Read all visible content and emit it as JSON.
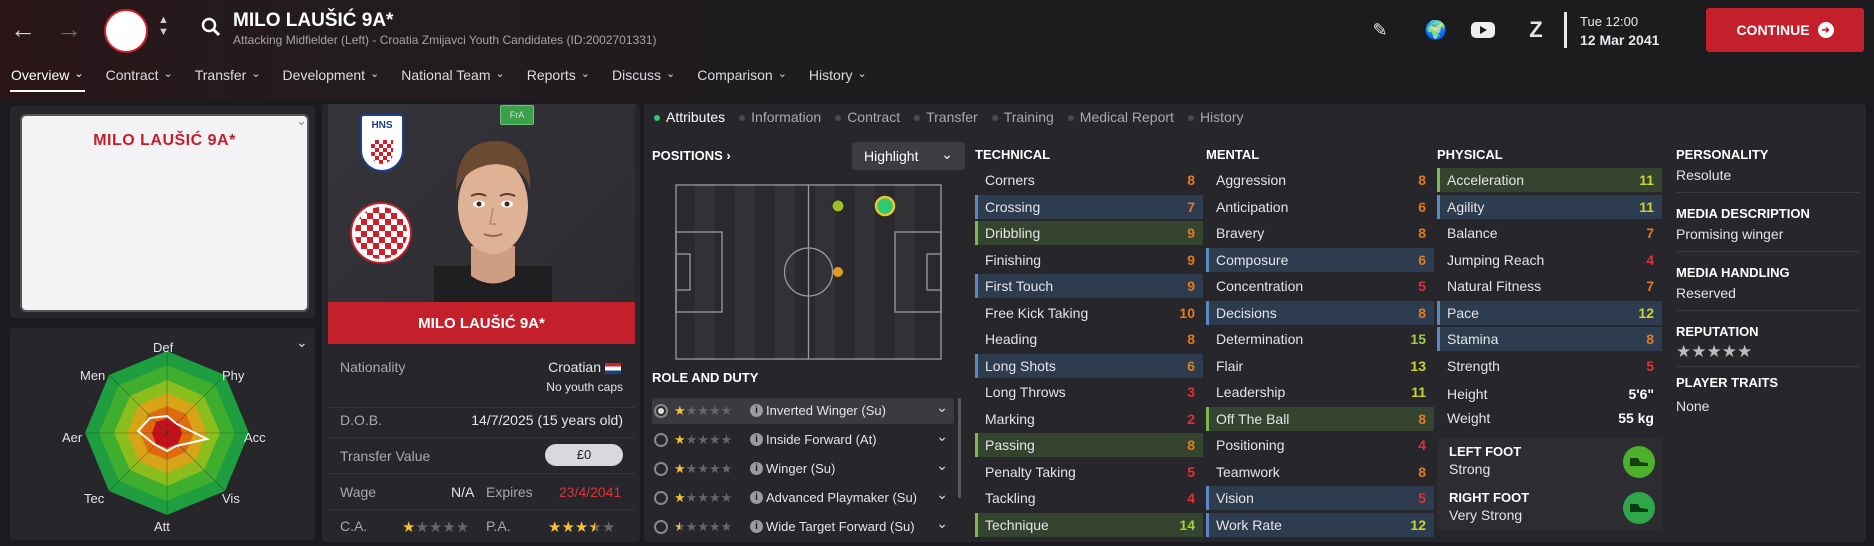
{
  "header": {
    "player_name": "MILO LAUŠIĆ 9A*",
    "player_sub": "Attacking Midfielder (Left) - Croatia Zmijavci Youth Candidates (ID:2002701331)",
    "date_day": "Tue 12:00",
    "date_date": "12 Mar 2041",
    "continue_label": "CONTINUE"
  },
  "main_nav": [
    "Overview",
    "Contract",
    "Transfer",
    "Development",
    "National Team",
    "Reports",
    "Discuss",
    "Comparison",
    "History"
  ],
  "portrait": {
    "name": "MILO LAUŠIĆ 9A*"
  },
  "radar": {
    "labels": {
      "def": "Def",
      "phy": "Phy",
      "acc": "Acc",
      "vis": "Vis",
      "att": "Att",
      "tec": "Tec",
      "aer": "Aer",
      "men": "Men"
    }
  },
  "card": {
    "name": "MILO LAUŠIĆ 9A*",
    "badge": "FrA",
    "nationality_label": "Nationality",
    "nationality_value": "Croatian",
    "youth_caps": "No youth caps",
    "dob_label": "D.O.B.",
    "dob_value": "14/7/2025 (15 years old)",
    "transfer_label": "Transfer Value",
    "transfer_value": "£0",
    "wage_label": "Wage",
    "wage_value": "N/A",
    "expires_label": "Expires",
    "expires_value": "23/4/2041",
    "ca_label": "C.A.",
    "pa_label": "P.A.",
    "ca_stars": 1,
    "pa_stars": 3.5
  },
  "subtabs": [
    "Attributes",
    "Information",
    "Contract",
    "Transfer",
    "Training",
    "Medical Report",
    "History"
  ],
  "positions": {
    "title": "POSITIONS",
    "highlight_label": "Highlight"
  },
  "role_duty": {
    "title": "ROLE AND DUTY",
    "roles": [
      {
        "name": "Inverted Winger (Su)",
        "stars": 1
      },
      {
        "name": "Inside Forward (At)",
        "stars": 1
      },
      {
        "name": "Winger (Su)",
        "stars": 1
      },
      {
        "name": "Advanced Playmaker (Su)",
        "stars": 1
      },
      {
        "name": "Wide Target Forward (Su)",
        "stars": 0.5
      }
    ]
  },
  "technical": {
    "title": "TECHNICAL",
    "items": [
      {
        "name": "Corners",
        "value": "8",
        "hl": ""
      },
      {
        "name": "Crossing",
        "value": "7",
        "hl": "blue"
      },
      {
        "name": "Dribbling",
        "value": "9",
        "hl": "green"
      },
      {
        "name": "Finishing",
        "value": "9",
        "hl": ""
      },
      {
        "name": "First Touch",
        "value": "9",
        "hl": "blue"
      },
      {
        "name": "Free Kick Taking",
        "value": "10",
        "hl": ""
      },
      {
        "name": "Heading",
        "value": "8",
        "hl": ""
      },
      {
        "name": "Long Shots",
        "value": "6",
        "hl": "blue"
      },
      {
        "name": "Long Throws",
        "value": "3",
        "hl": ""
      },
      {
        "name": "Marking",
        "value": "2",
        "hl": ""
      },
      {
        "name": "Passing",
        "value": "8",
        "hl": "green"
      },
      {
        "name": "Penalty Taking",
        "value": "5",
        "hl": ""
      },
      {
        "name": "Tackling",
        "value": "4",
        "hl": ""
      },
      {
        "name": "Technique",
        "value": "14",
        "hl": "green"
      }
    ]
  },
  "mental": {
    "title": "MENTAL",
    "items": [
      {
        "name": "Aggression",
        "value": "8",
        "hl": ""
      },
      {
        "name": "Anticipation",
        "value": "6",
        "hl": ""
      },
      {
        "name": "Bravery",
        "value": "8",
        "hl": ""
      },
      {
        "name": "Composure",
        "value": "6",
        "hl": "blue"
      },
      {
        "name": "Concentration",
        "value": "5",
        "hl": ""
      },
      {
        "name": "Decisions",
        "value": "8",
        "hl": "blue"
      },
      {
        "name": "Determination",
        "value": "15",
        "hl": ""
      },
      {
        "name": "Flair",
        "value": "13",
        "hl": ""
      },
      {
        "name": "Leadership",
        "value": "11",
        "hl": ""
      },
      {
        "name": "Off The Ball",
        "value": "8",
        "hl": "green"
      },
      {
        "name": "Positioning",
        "value": "4",
        "hl": ""
      },
      {
        "name": "Teamwork",
        "value": "8",
        "hl": ""
      },
      {
        "name": "Vision",
        "value": "5",
        "hl": "blue"
      },
      {
        "name": "Work Rate",
        "value": "12",
        "hl": "blue"
      }
    ]
  },
  "physical": {
    "title": "PHYSICAL",
    "items": [
      {
        "name": "Acceleration",
        "value": "11",
        "hl": "green"
      },
      {
        "name": "Agility",
        "value": "11",
        "hl": "blue"
      },
      {
        "name": "Balance",
        "value": "7",
        "hl": ""
      },
      {
        "name": "Jumping Reach",
        "value": "4",
        "hl": ""
      },
      {
        "name": "Natural Fitness",
        "value": "7",
        "hl": ""
      },
      {
        "name": "Pace",
        "value": "12",
        "hl": "blue"
      },
      {
        "name": "Stamina",
        "value": "8",
        "hl": "blue"
      },
      {
        "name": "Strength",
        "value": "5",
        "hl": ""
      }
    ],
    "height_label": "Height",
    "height_value": "5'6\"",
    "weight_label": "Weight",
    "weight_value": "55 kg",
    "left_foot_label": "LEFT FOOT",
    "left_foot_value": "Strong",
    "right_foot_label": "RIGHT FOOT",
    "right_foot_value": "Very Strong"
  },
  "personality": {
    "personality_label": "PERSONALITY",
    "personality_value": "Resolute",
    "media_desc_label": "MEDIA DESCRIPTION",
    "media_desc_value": "Promising winger",
    "media_handling_label": "MEDIA HANDLING",
    "media_handling_value": "Reserved",
    "reputation_label": "REPUTATION",
    "reputation_stars": 0,
    "traits_label": "PLAYER TRAITS",
    "traits_value": "None"
  },
  "colors": {
    "accent": "#c3202b",
    "good": "#9fd23a",
    "mid": "#e37b1e",
    "bad": "#e0303a",
    "great": "#5ec82e"
  }
}
